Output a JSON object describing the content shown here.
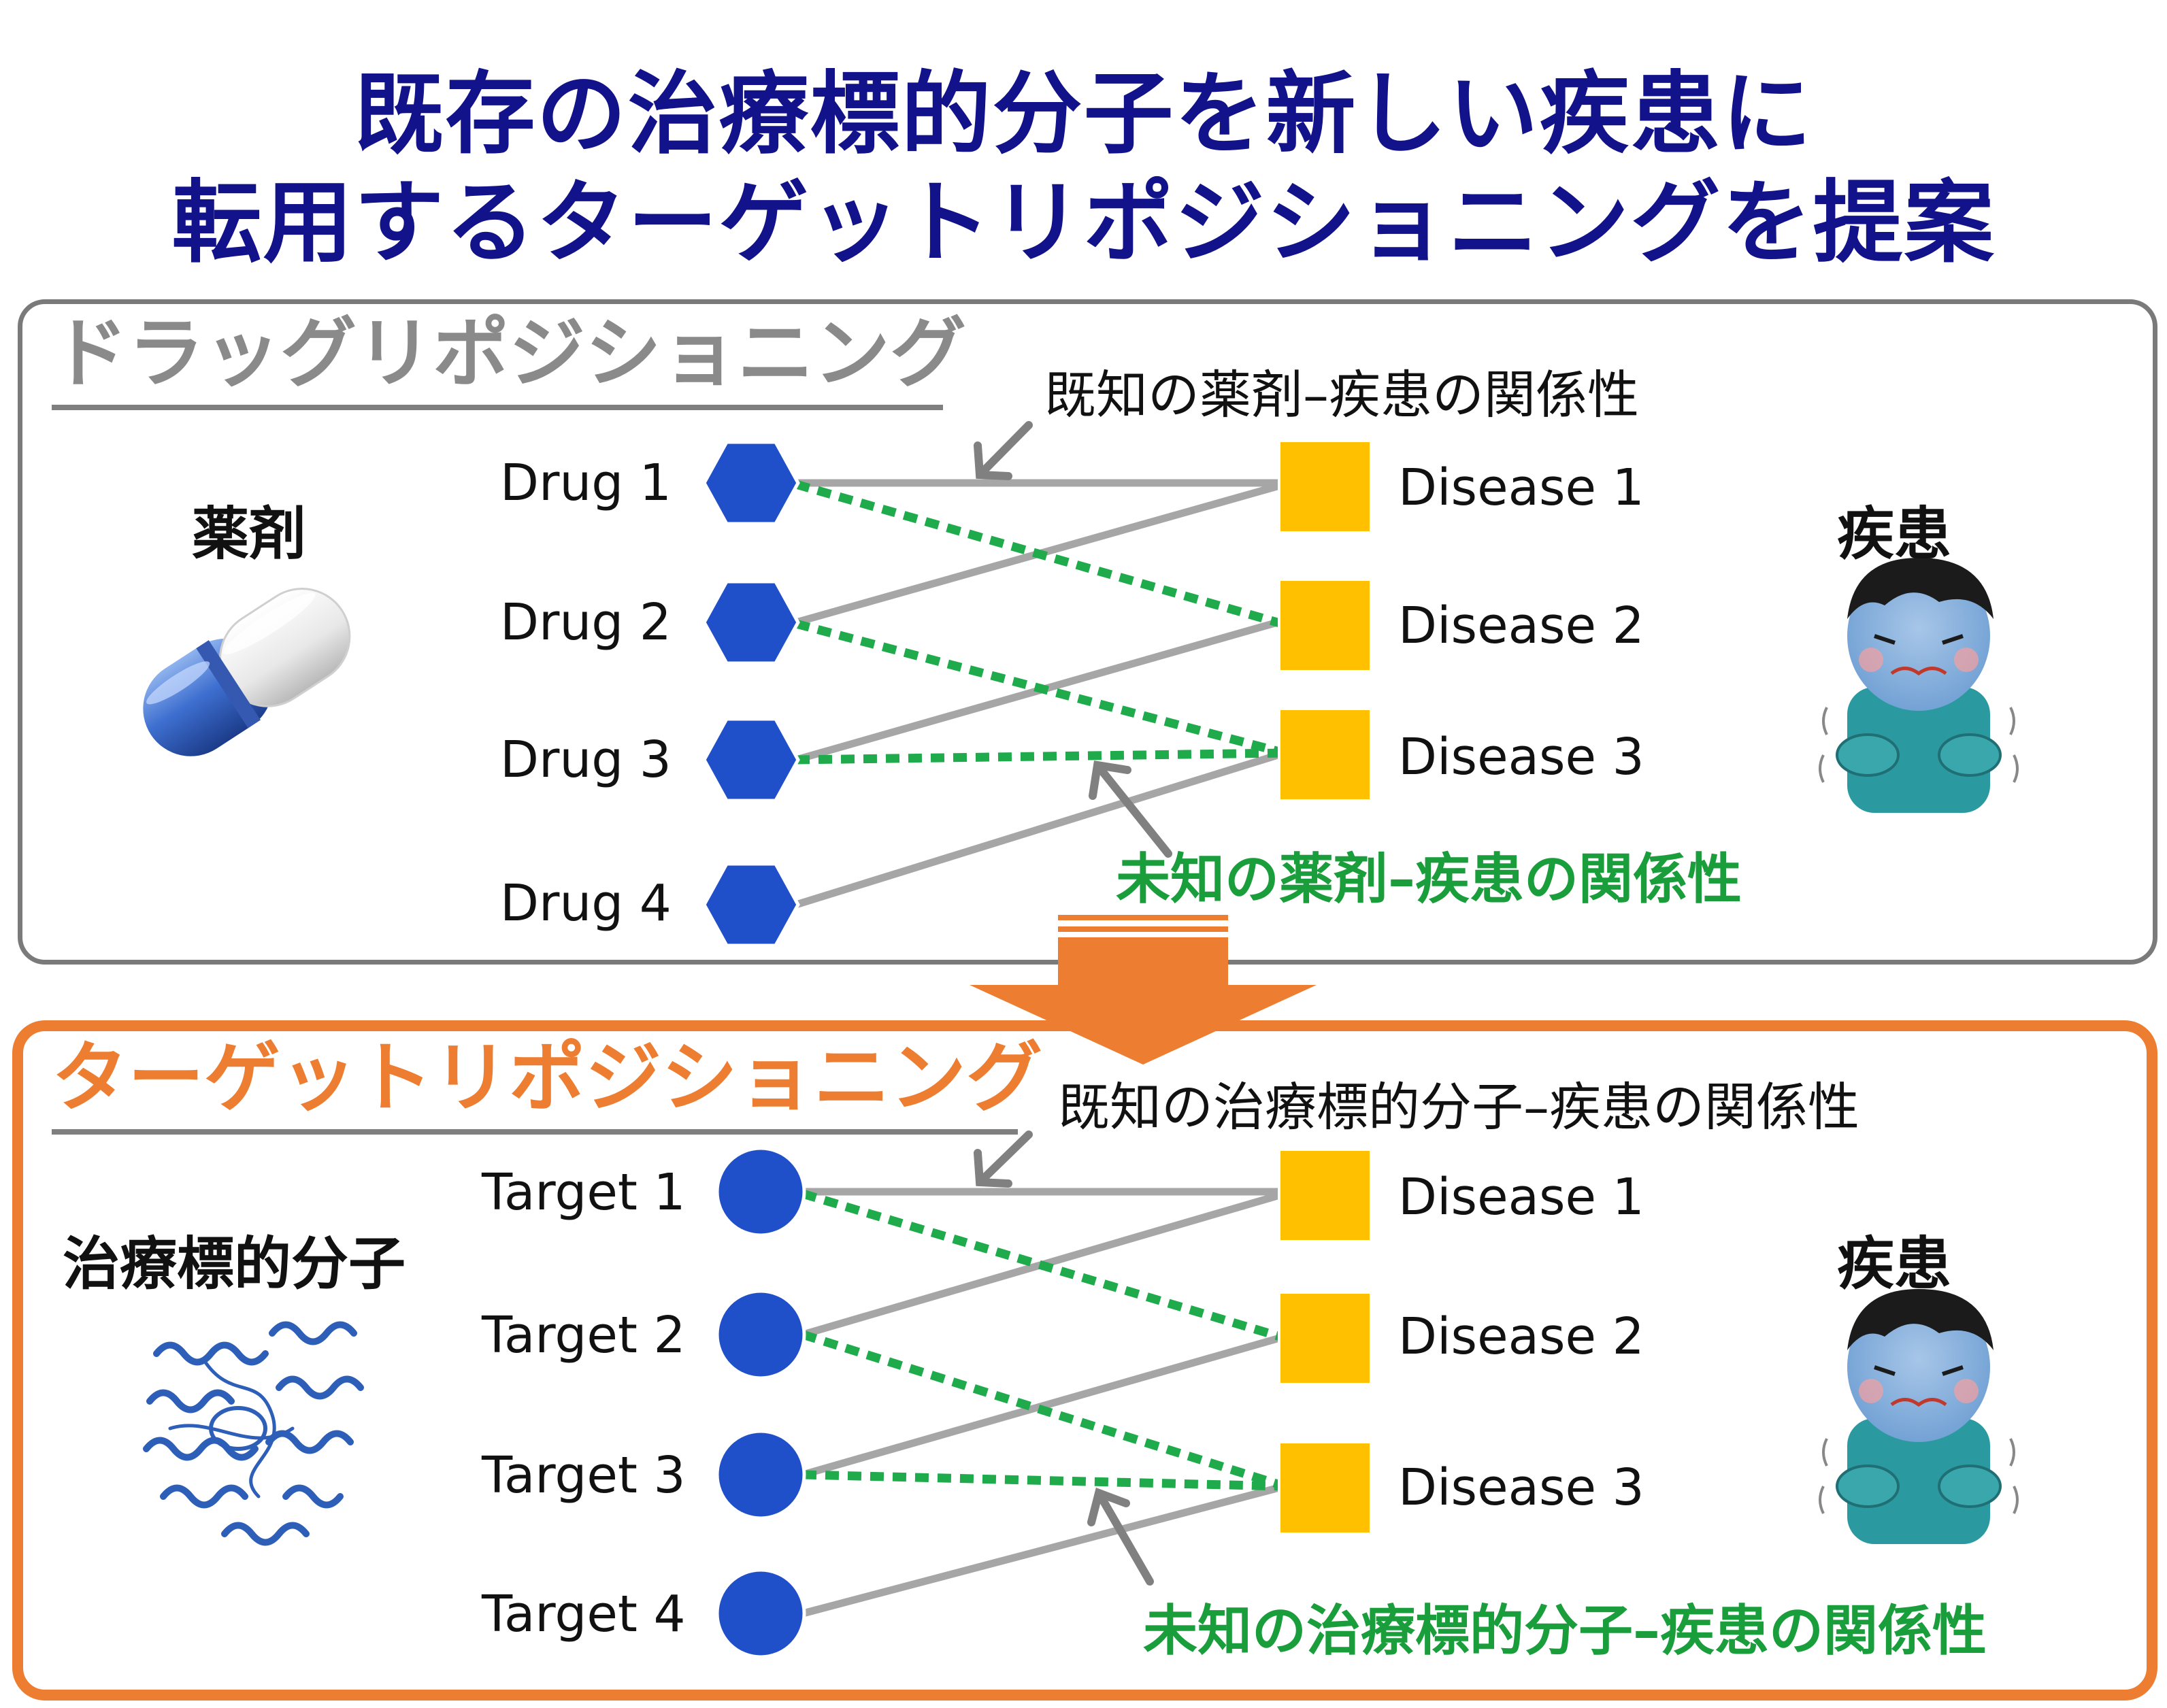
{
  "title": {
    "line1": "既存の治療標的分子を新しい疾患に",
    "line2": "転用するターゲットリポジショニングを提案"
  },
  "drug_panel": {
    "heading": "ドラッグリポジショニング",
    "left_label": "薬剤",
    "right_label": "疾患",
    "known_label": "既知の薬剤–疾患の関係性",
    "unknown_label": "未知の薬剤–疾患の関係性",
    "nodes": [
      "Drug 1",
      "Drug 2",
      "Drug 3",
      "Drug 4"
    ],
    "diseases": [
      "Disease 1",
      "Disease 2",
      "Disease 3"
    ]
  },
  "target_panel": {
    "heading": "ターゲットリポジショニング",
    "left_label": "治療標的分子",
    "right_label": "疾患",
    "known_label": "既知の治療標的分子–疾患の関係性",
    "unknown_label": "未知の治療標的分子–疾患の関係性",
    "nodes": [
      "Target 1",
      "Target 2",
      "Target 3",
      "Target 4"
    ],
    "diseases": [
      "Disease 1",
      "Disease 2",
      "Disease 3"
    ]
  },
  "colors": {
    "title": "#12128a",
    "node_blue": "#1f4fc9",
    "disease_yellow": "#ffc000",
    "known_edge": "#a6a6a6",
    "unknown_edge": "#1faa4b",
    "accent_orange": "#ed7d31"
  }
}
